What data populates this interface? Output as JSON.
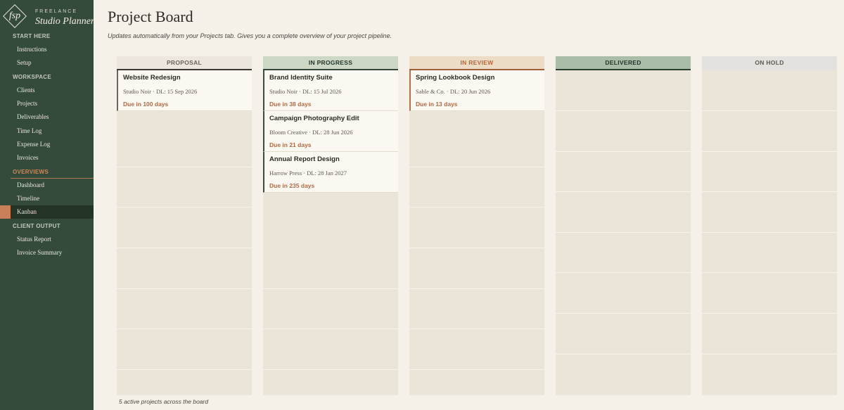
{
  "brand": {
    "logo_text": "fsp",
    "top": "FREELANCE",
    "name": "Studio Planner"
  },
  "sidebar": {
    "sections": [
      {
        "label": "START HERE",
        "items": [
          "Instructions",
          "Setup"
        ]
      },
      {
        "label": "WORKSPACE",
        "items": [
          "Clients",
          "Projects",
          "Deliverables",
          "Time Log",
          "Expense Log",
          "Invoices"
        ]
      },
      {
        "label": "OVERVIEWS",
        "items": [
          "Dashboard",
          "Timeline",
          "Kanban"
        ]
      },
      {
        "label": "CLIENT OUTPUT",
        "items": [
          "Status Report",
          "Invoice Summary"
        ]
      }
    ],
    "active_item": "Kanban"
  },
  "page": {
    "title": "Project Board",
    "subtitle": "Updates automatically from your Projects tab. Gives you a complete overview of your project pipeline.",
    "footer": "5 active projects across the board"
  },
  "columns": [
    {
      "label": "PROPOSAL",
      "cards": [
        {
          "title": "Website Redesign",
          "meta": "Studio Noir · DL: 15 Sep 2026",
          "due": "Due in 100 days"
        }
      ]
    },
    {
      "label": "IN PROGRESS",
      "cards": [
        {
          "title": "Brand Identity Suite",
          "meta": "Studio Noir · DL: 15 Jul 2026",
          "due": "Due in 38 days"
        },
        {
          "title": "Campaign Photography Edit",
          "meta": "Bloom Creative · DL: 28 Jun 2026",
          "due": "Due in 21 days"
        },
        {
          "title": "Annual Report Design",
          "meta": "Harrow Press · DL: 28 Jan 2027",
          "due": "Due in 235 days"
        }
      ]
    },
    {
      "label": "IN REVIEW",
      "cards": [
        {
          "title": "Spring Lookbook Design",
          "meta": "Sable & Co. · DL: 20 Jun 2026",
          "due": "Due in 13 days"
        }
      ]
    },
    {
      "label": "DELIVERED",
      "cards": []
    },
    {
      "label": "ON HOLD",
      "cards": []
    }
  ],
  "colors": {
    "sidebar_bg": "#344a3b",
    "accent": "#c97f5a",
    "background": "#f5f1e8",
    "due_text": "#ad6a42"
  }
}
